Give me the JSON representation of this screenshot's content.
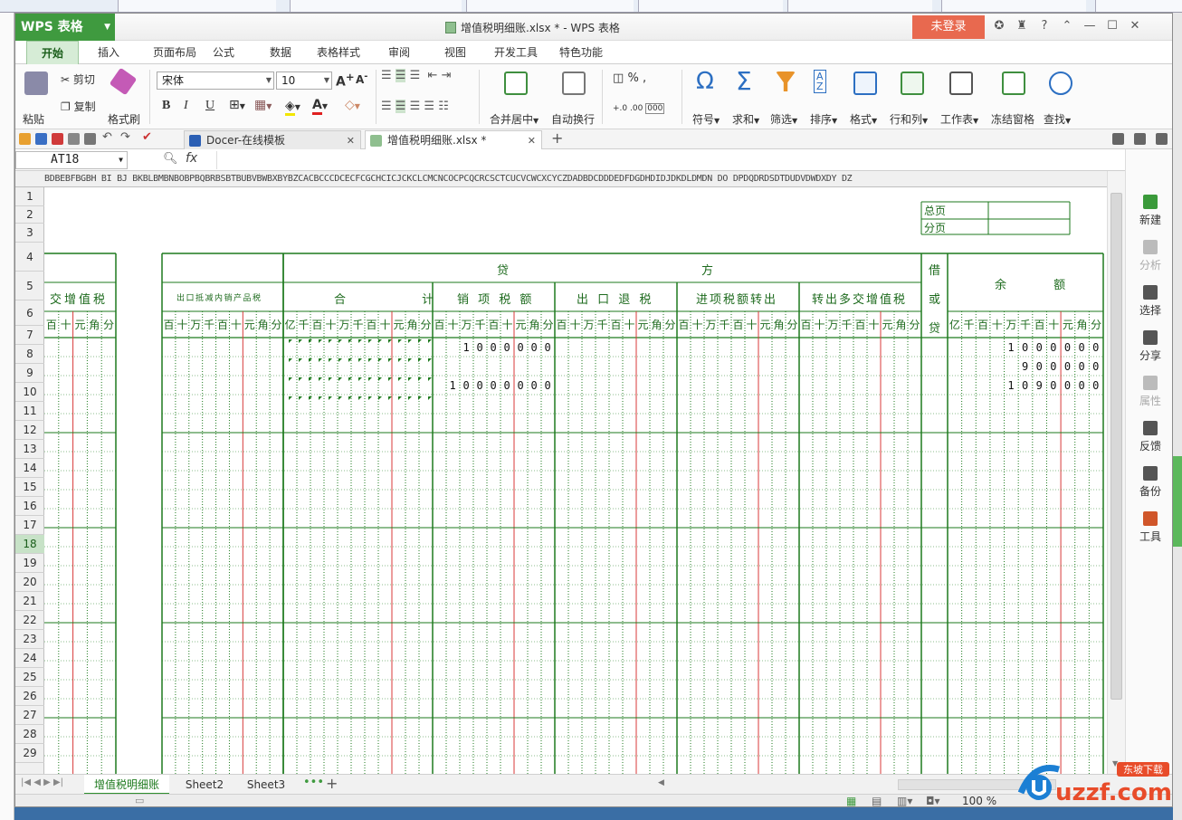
{
  "window": {
    "app_button": "WPS 表格",
    "title": "增值税明细账.xlsx * - WPS 表格",
    "login_label": "未登录",
    "help_label": "?"
  },
  "ribbon_tabs": [
    "开始",
    "插入",
    "页面布局",
    "公式",
    "数据",
    "表格样式",
    "审阅",
    "视图",
    "开发工具",
    "特色功能"
  ],
  "ribbon": {
    "paste": "粘贴",
    "cut": "剪切",
    "copy": "复制",
    "format_painter": "格式刷",
    "font_name": "宋体",
    "font_size": "10",
    "bold": "B",
    "italic": "I",
    "underline": "U",
    "font_color_letter": "A",
    "grow_font": "A",
    "shrink_font": "A",
    "merge_center": "合并居中",
    "wrap_text": "自动换行",
    "percent": "%",
    "thousands": "000",
    "symbol": "符号",
    "sum": "求和",
    "filter": "筛选",
    "sort": "排序",
    "format": "格式",
    "rows_cols": "行和列",
    "worksheet": "工作表",
    "freeze": "冻结窗格",
    "find": "查找"
  },
  "doc_tabs": [
    {
      "label": "Docer-在线模板"
    },
    {
      "label": "增值税明细账.xlsx *"
    }
  ],
  "formula_bar": {
    "name_box": "AT18",
    "fx": "fx"
  },
  "column_header_text": "BDBEBFBGBH  BI  BJ BKBLBMBNBOBPBQBRBSBTBUBVBWBXBYBZCACBCCCDCECFCGCHCICJCKCLCMCNCOCPCQCRCSCTCUCVCWCXCYCZDADBDCDDDEDFDGDHDIDJDKDLDMDN  DO  DPDQDRDSDTDUDVDWDXDY DZ",
  "row_numbers": [
    "1",
    "2",
    "3",
    "4",
    "5",
    "6",
    "7",
    "8",
    "9",
    "10",
    "11",
    "12",
    "13",
    "14",
    "15",
    "16",
    "17",
    "18",
    "19",
    "20",
    "21",
    "22",
    "23",
    "24",
    "25",
    "26",
    "27",
    "28",
    "29"
  ],
  "selected_row": "18",
  "sheet": {
    "total_pages": "总页",
    "sub_pages": "分页",
    "col_title_left": "交增值税",
    "export_deduct": "出口抵减内销产品税",
    "credit": "贷",
    "credit_fang": "方",
    "sub_total": "合 计",
    "sales_tax": "销 项 税 额",
    "export_refund": "出 口 退 税",
    "input_transfer": "进项税额转出",
    "overpaid_transfer": "转出多交增值税",
    "debit_or_credit": [
      "借",
      "或",
      "贷"
    ],
    "balance": "余 额",
    "units_left": [
      "百",
      "十",
      "元",
      "角",
      "分"
    ],
    "units_8": [
      "百",
      "十",
      "万",
      "千",
      "百",
      "十",
      "元",
      "角",
      "分"
    ],
    "units_10": [
      "亿",
      "千",
      "百",
      "十",
      "万",
      "千",
      "百",
      "十",
      "元",
      "角",
      "分"
    ],
    "sales_values": [
      "1000000",
      "",
      "10000000"
    ],
    "balance_values": [
      "1000000",
      "900000",
      "1090000"
    ]
  },
  "side_panel": [
    {
      "label": "新建",
      "enabled": true,
      "color": "#3a9a3a"
    },
    {
      "label": "分析",
      "enabled": false,
      "color": "#bbbbbb"
    },
    {
      "label": "选择",
      "enabled": true,
      "color": "#555555"
    },
    {
      "label": "分享",
      "enabled": true,
      "color": "#555555"
    },
    {
      "label": "属性",
      "enabled": false,
      "color": "#bbbbbb"
    },
    {
      "label": "反馈",
      "enabled": true,
      "color": "#555555"
    },
    {
      "label": "备份",
      "enabled": true,
      "color": "#555555"
    },
    {
      "label": "工具",
      "enabled": true,
      "color": "#d0562a"
    }
  ],
  "sheet_tabs": [
    "增值税明细账",
    "Sheet2",
    "Sheet3"
  ],
  "status": {
    "zoom": "100 %"
  },
  "watermark": {
    "text": "uzzf.com",
    "sub": "东坡下载"
  },
  "colors": {
    "accent_green": "#3f9a3f",
    "login_red": "#e8694f",
    "grid_green": "#1e7a1e",
    "red_line": "#d83a3a"
  }
}
